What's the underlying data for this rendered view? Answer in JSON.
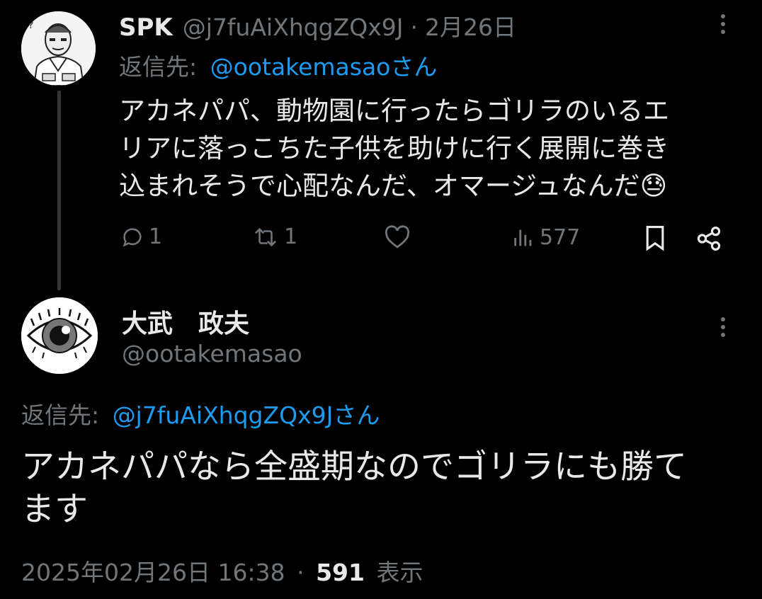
{
  "tweet1": {
    "display_name": "SPK",
    "handle": "@j7fuAiXhqgZQx9J",
    "separator": "·",
    "date": "2月26日",
    "reply_prefix": "返信先:",
    "reply_to": "@ootakemasaoさん",
    "body_lines": [
      "アカネパパ、動物園に行ったらゴリラのいるエ",
      "リアに落っこちた子供を助けに行く展開に巻き",
      "込まれそうで心配なんだ、オマージュなんだ"
    ],
    "emoji": "😓",
    "replies": "1",
    "reposts": "1",
    "views": "577"
  },
  "tweet2": {
    "display_name": "大武　政夫",
    "handle": "@ootakemasao",
    "reply_prefix": "返信先:",
    "reply_to": "@j7fuAiXhqgZQx9Jさん",
    "body_lines": [
      "アカネパパなら全盛期なのでゴリラにも勝て",
      "ます"
    ],
    "timestamp": "2025年02月26日 16:38",
    "separator": "·",
    "views_count": "591",
    "views_label": "表示"
  },
  "icons": [
    "reply-icon",
    "repost-icon",
    "like-icon",
    "views-icon",
    "bookmark-icon",
    "share-icon",
    "more-icon"
  ],
  "colors": {
    "background": "#000000",
    "text": "#e7e9ea",
    "muted": "#71767b",
    "link": "#1d9bf0"
  }
}
